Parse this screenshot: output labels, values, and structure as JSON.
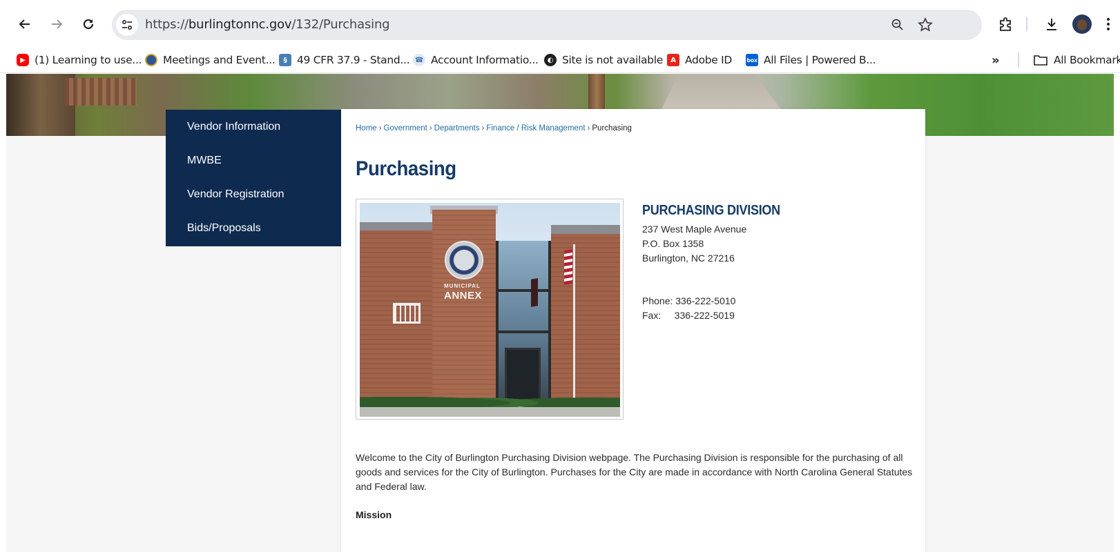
{
  "browser": {
    "url_scheme": "https://",
    "url_host": "burlingtonnc.gov",
    "url_path": "/132/Purchasing",
    "bookmarks": [
      {
        "label": "(1) Learning to use...",
        "icon": "youtube-icon",
        "color": "#ff0000"
      },
      {
        "label": "Meetings and Event...",
        "icon": "seal-icon",
        "color": "#2f5597"
      },
      {
        "label": "49 CFR 37.9 - Stand...",
        "icon": "document-icon",
        "color": "#4a7fb5"
      },
      {
        "label": "Account Informatio...",
        "icon": "phone-icon",
        "color": "#3a6ea5"
      },
      {
        "label": "Site is not available",
        "icon": "globe-icon",
        "color": "#1f1f1f"
      },
      {
        "label": "Adobe ID",
        "icon": "adobe-icon",
        "color": "#e5251b"
      },
      {
        "label": "All Files | Powered B...",
        "icon": "box-icon",
        "color": "#0061d5"
      }
    ],
    "overflow_label": "»",
    "all_bookmarks_label": "All Bookmarks"
  },
  "side_nav": {
    "items": [
      "Vendor Information",
      "MWBE",
      "Vendor Registration",
      "Bids/Proposals"
    ],
    "background": "#0e2a4f"
  },
  "breadcrumb": {
    "links": [
      "Home",
      "Government",
      "Departments",
      "Finance / Risk Management"
    ],
    "current": "Purchasing",
    "separator": "›"
  },
  "page": {
    "title": "Purchasing",
    "photo_sign_small": "MUNICIPAL",
    "photo_sign_large": "ANNEX",
    "division": {
      "title": "PURCHASING DIVISION",
      "address_line1": "237 West Maple Avenue",
      "address_line2": "P.O. Box 1358",
      "address_line3": "Burlington, NC 27216",
      "phone": "Phone: 336-222-5010",
      "fax": "Fax:     336-222-5019"
    },
    "intro": "Welcome to the City of Burlington Purchasing Division webpage.  The Purchasing Division is responsible for the purchasing of all goods and services for the City of Burlington.  Purchases for the City are made in accordance with North Carolina General Statutes and Federal law.",
    "mission_heading": "Mission",
    "accent_color": "#163a66",
    "link_color": "#1d6ea3"
  }
}
